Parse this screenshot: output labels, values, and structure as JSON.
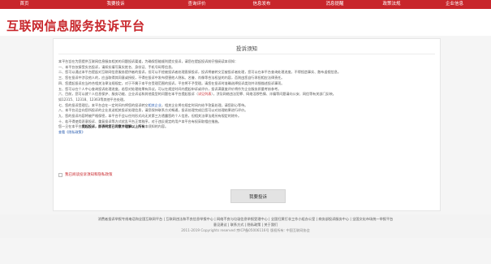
{
  "topnav": {
    "items": [
      "首页",
      "我要投诉",
      "查询评价",
      "信息发布",
      "消息提醒",
      "政策法规",
      "企业信息"
    ],
    "bg_color": "#c8262b"
  },
  "header": {
    "title": "互联网信息服务投诉平台"
  },
  "notice": {
    "title": "投诉须知",
    "intro": "本平台旨在为您提供互联网信息服务相关的问题投诉渠道，为确保您能顺利提交投诉，请您在提起投诉前仔细阅读本须知：",
    "items": [
      "一、本平台仅接受实名投诉，请如实填写真实姓名、身份证、手机号码等信息。",
      "二、您可以通过本平台提起对互联网信息服务提供者的投诉，但可以不经被投诉者处理直接投诉，投诉将被转交至被投诉者处理，您可以在本平台查询处理进度，不得捏造事实、散布虚假信息。",
      "三、您在投诉中涉及他人的，应当取得其同意或授权，不得在投诉中发布侵害他人隐私、名誉、肖像等合法权益的内容，否则由您自行承担相应法律责任。",
      "四、您提起投诉应当符合相关法律法规规定，对于不属于本平台受理范围的投诉，平台将不予受理。请您在投诉时准确选择投诉类别并详细描述投诉事项。",
      "五、您可以在个人中心查询投诉处理进度，若您对处理结果有异议，可以在规定时间内提起申诉或评价，投诉满意度评价将作为企业服务质量考核参考。"
    ],
    "item6_pre": "六、目前，您可以就个人信息保护、服务功能、企业诉讼和其他类型的问题在本平台提起投诉（",
    "item6_link": "详见列表",
    "item6_post": "），涉及网络违法犯罪、网络淫秽色情、诈骗等问题请向公安、网信等有关部门反映。",
    "item6_cont": "如12315、12318、12363等其他平台处理。",
    "item7_pre": "七、您的投诉受理后，本平台会在一定时间内将您的投诉转交",
    "item7_link": "相关企业",
    "item7_post": "，相关企业将在规定时间内给予答复处理，请您耐心等待。",
    "items_rest": [
      "八、本平台还会向您所投诉的企业发送相关投诉处理信息，请您保持联系方式畅通，投诉处理完成后您可以对处理结果进行评价。",
      "九、您的投诉内容将被严格保密，本平台不会以任何形式向无关第三方透露您的个人信息，但相关法律法规另有规定的除外。",
      "十、若不得使用恶意投诉、重复投诉等方式扰乱平台正常秩序，对于违反规定的用户本平台有权采取相应措施。"
    ],
    "closing_pre": "您一旦在本平台",
    "closing_strong": "提起投诉，即表明您已同意并理解以上所有",
    "closing_post": "本须知的内容。",
    "privacy_link": "查看《隐私政策》"
  },
  "agree": {
    "label": "我已阅读投诉须知和隐私政策"
  },
  "submit": {
    "label": "我要投诉"
  },
  "footer": {
    "line1": "消费者投诉举报专线电话和全国互联网平台 | 互联网违法和不良信息举报中心 | 网络不良与垃圾信息举报受理中心 | 全国扫黄打非工作小组办公室 | 商务部投诉服务中心 | 全国文化市场统一举报平台",
    "line2": "意见建议 | 联系方式 | 隐私政策 | 关于我们",
    "line3": "2011-2019 Copyrights reserved 京ICP备05006116号 版权所有: 中国互联网协会"
  }
}
